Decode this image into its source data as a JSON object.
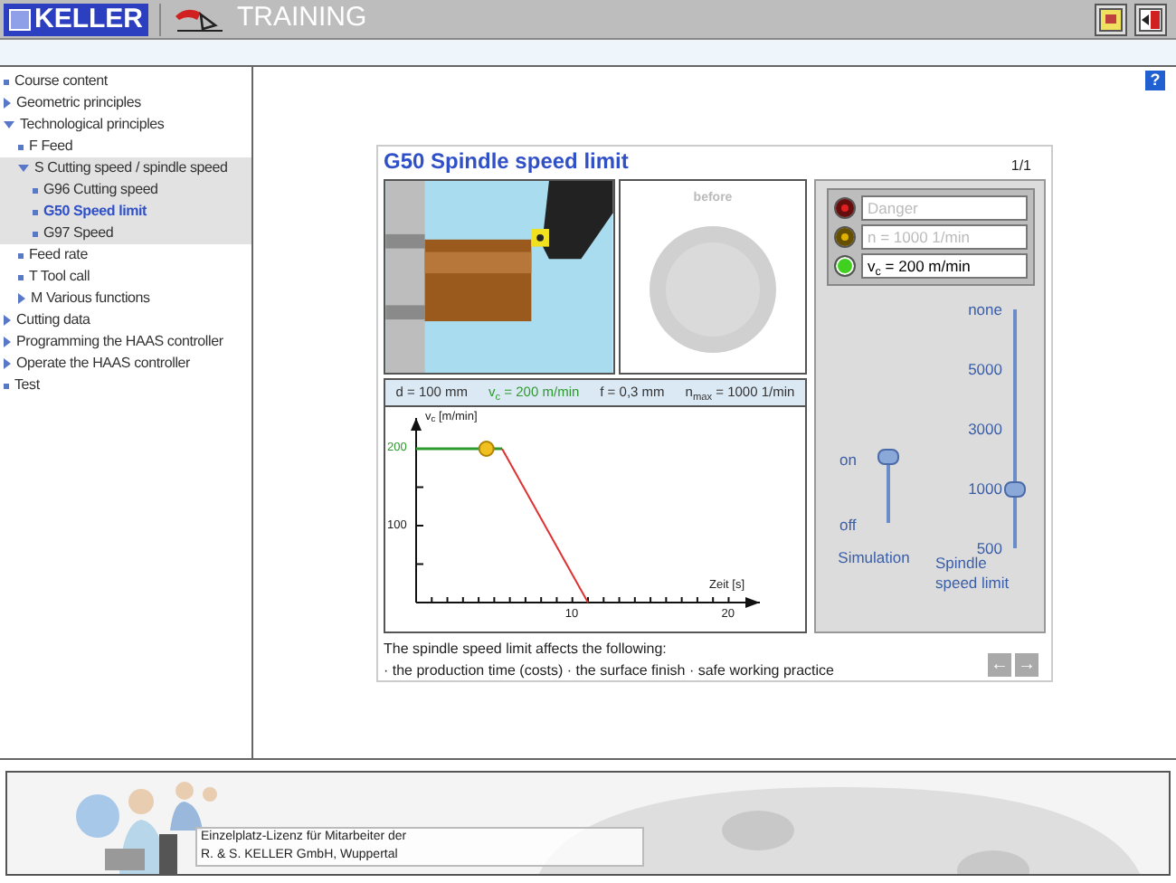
{
  "header": {
    "title": "TRAINING",
    "logo": "KELLER",
    "buttons": [
      {
        "kind": "notes"
      },
      {
        "kind": "exit"
      }
    ]
  },
  "sidebar": {
    "items": [
      {
        "label": "Course content",
        "kind": "page",
        "selected": false
      },
      {
        "label": "Geometric principles",
        "kind": "folder",
        "selected": false
      },
      {
        "label": "Technological principles",
        "kind": "folder",
        "expanded": true,
        "selected": false,
        "children": [
          {
            "label": "F Feed",
            "kind": "page",
            "selected": false
          },
          {
            "label": "S Cutting speed / spindle speed",
            "kind": "folder",
            "expanded": true,
            "selected": false,
            "children": [
              {
                "label": "G96 Cutting speed",
                "kind": "page",
                "selected": false
              },
              {
                "label": "G50 Speed limit",
                "kind": "page",
                "selected": true
              },
              {
                "label": "G97 Speed",
                "kind": "page",
                "selected": false
              }
            ]
          },
          {
            "label": "Feed rate",
            "kind": "page",
            "selected": false
          },
          {
            "label": "T Tool call",
            "kind": "page",
            "selected": false
          },
          {
            "label": "M Various functions",
            "kind": "folder",
            "selected": false
          }
        ]
      },
      {
        "label": "Cutting data",
        "kind": "folder",
        "selected": false
      },
      {
        "label": "Programming the HAAS controller",
        "kind": "folder",
        "selected": false
      },
      {
        "label": "Operate the HAAS controller",
        "kind": "folder",
        "selected": false
      },
      {
        "label": "Test",
        "kind": "page",
        "selected": false
      }
    ]
  },
  "help": "?",
  "lesson": {
    "title": "G50 Spindle speed limit",
    "page": "1/1",
    "before_label": "before",
    "params": [
      {
        "text": "d = 100 mm",
        "color": "#333333"
      },
      {
        "text": "v$_{c}$ = 200 m/min",
        "color": "#2e9a2e"
      },
      {
        "text": "f = 0,3 mm",
        "color": "#333333"
      },
      {
        "text": "n$_{max}$ = 1000 1/min",
        "color": "#333333"
      }
    ],
    "chart_data": {
      "type": "line",
      "xlabel": "Zeit [s]",
      "ylabel": "v$_{c}$ [m/min]",
      "x": [
        0,
        5.5,
        11
      ],
      "series": [
        {
          "color": "#2e9a2e",
          "values": [
            200,
            200,
            null
          ]
        },
        {
          "color": "#e03030",
          "values": [
            null,
            200,
            0
          ]
        }
      ],
      "xlim": [
        0,
        22
      ],
      "ylim": [
        0,
        240
      ],
      "xticks": [
        10,
        20
      ],
      "yticks": [
        100,
        200
      ]
    },
    "lights": [
      {
        "text": "Danger",
        "color": "#e02020",
        "on": false
      },
      {
        "text": "n = 1000 1/min",
        "color": "#e0b000",
        "on": false
      },
      {
        "text": "v$_{c}$ = 200 m/min",
        "color": "#40d020",
        "on": true
      }
    ],
    "simulation": {
      "label": "Simulation",
      "on_label": "on",
      "off_label": "off",
      "on": true
    },
    "speed_limit": {
      "label": "Spindle speed limit",
      "ticks": [
        "none",
        "5000",
        "3000",
        "1000",
        "500"
      ],
      "level": 0.25
    },
    "description": "The spindle speed limit affects the following:",
    "points": "· the production time (costs) · the surface finish · safe working practice",
    "nav": [
      "←",
      "→"
    ]
  },
  "footer": {
    "license": [
      "Einzelplatz-Lizenz für Mitarbeiter der",
      "R. & S. KELLER GmbH, Wuppertal"
    ]
  }
}
